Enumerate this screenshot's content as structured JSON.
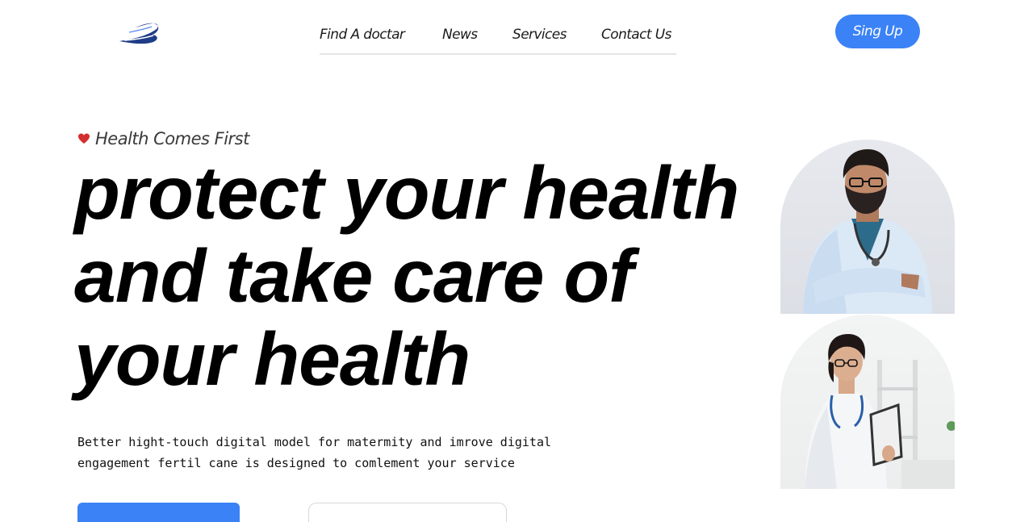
{
  "nav": {
    "items": [
      {
        "label": "Find A doctar"
      },
      {
        "label": "News"
      },
      {
        "label": "Services"
      },
      {
        "label": "Contact Us"
      }
    ],
    "signup_label": "Sing Up"
  },
  "hero": {
    "tagline": "Health Comes First",
    "headline_lines": [
      "protect your health",
      "and take care of",
      "your health"
    ],
    "description_lines": [
      "Better hight-touch digital model for matermity and imrove digital",
      "engagement fertil cane is designed to comlement your service"
    ]
  },
  "colors": {
    "accent": "#3b82f6",
    "heart": "#d32f2f",
    "logo": "#1f3c88"
  },
  "icons": {
    "logo": "brand-logo-icon",
    "tagline": "heart-icon"
  }
}
